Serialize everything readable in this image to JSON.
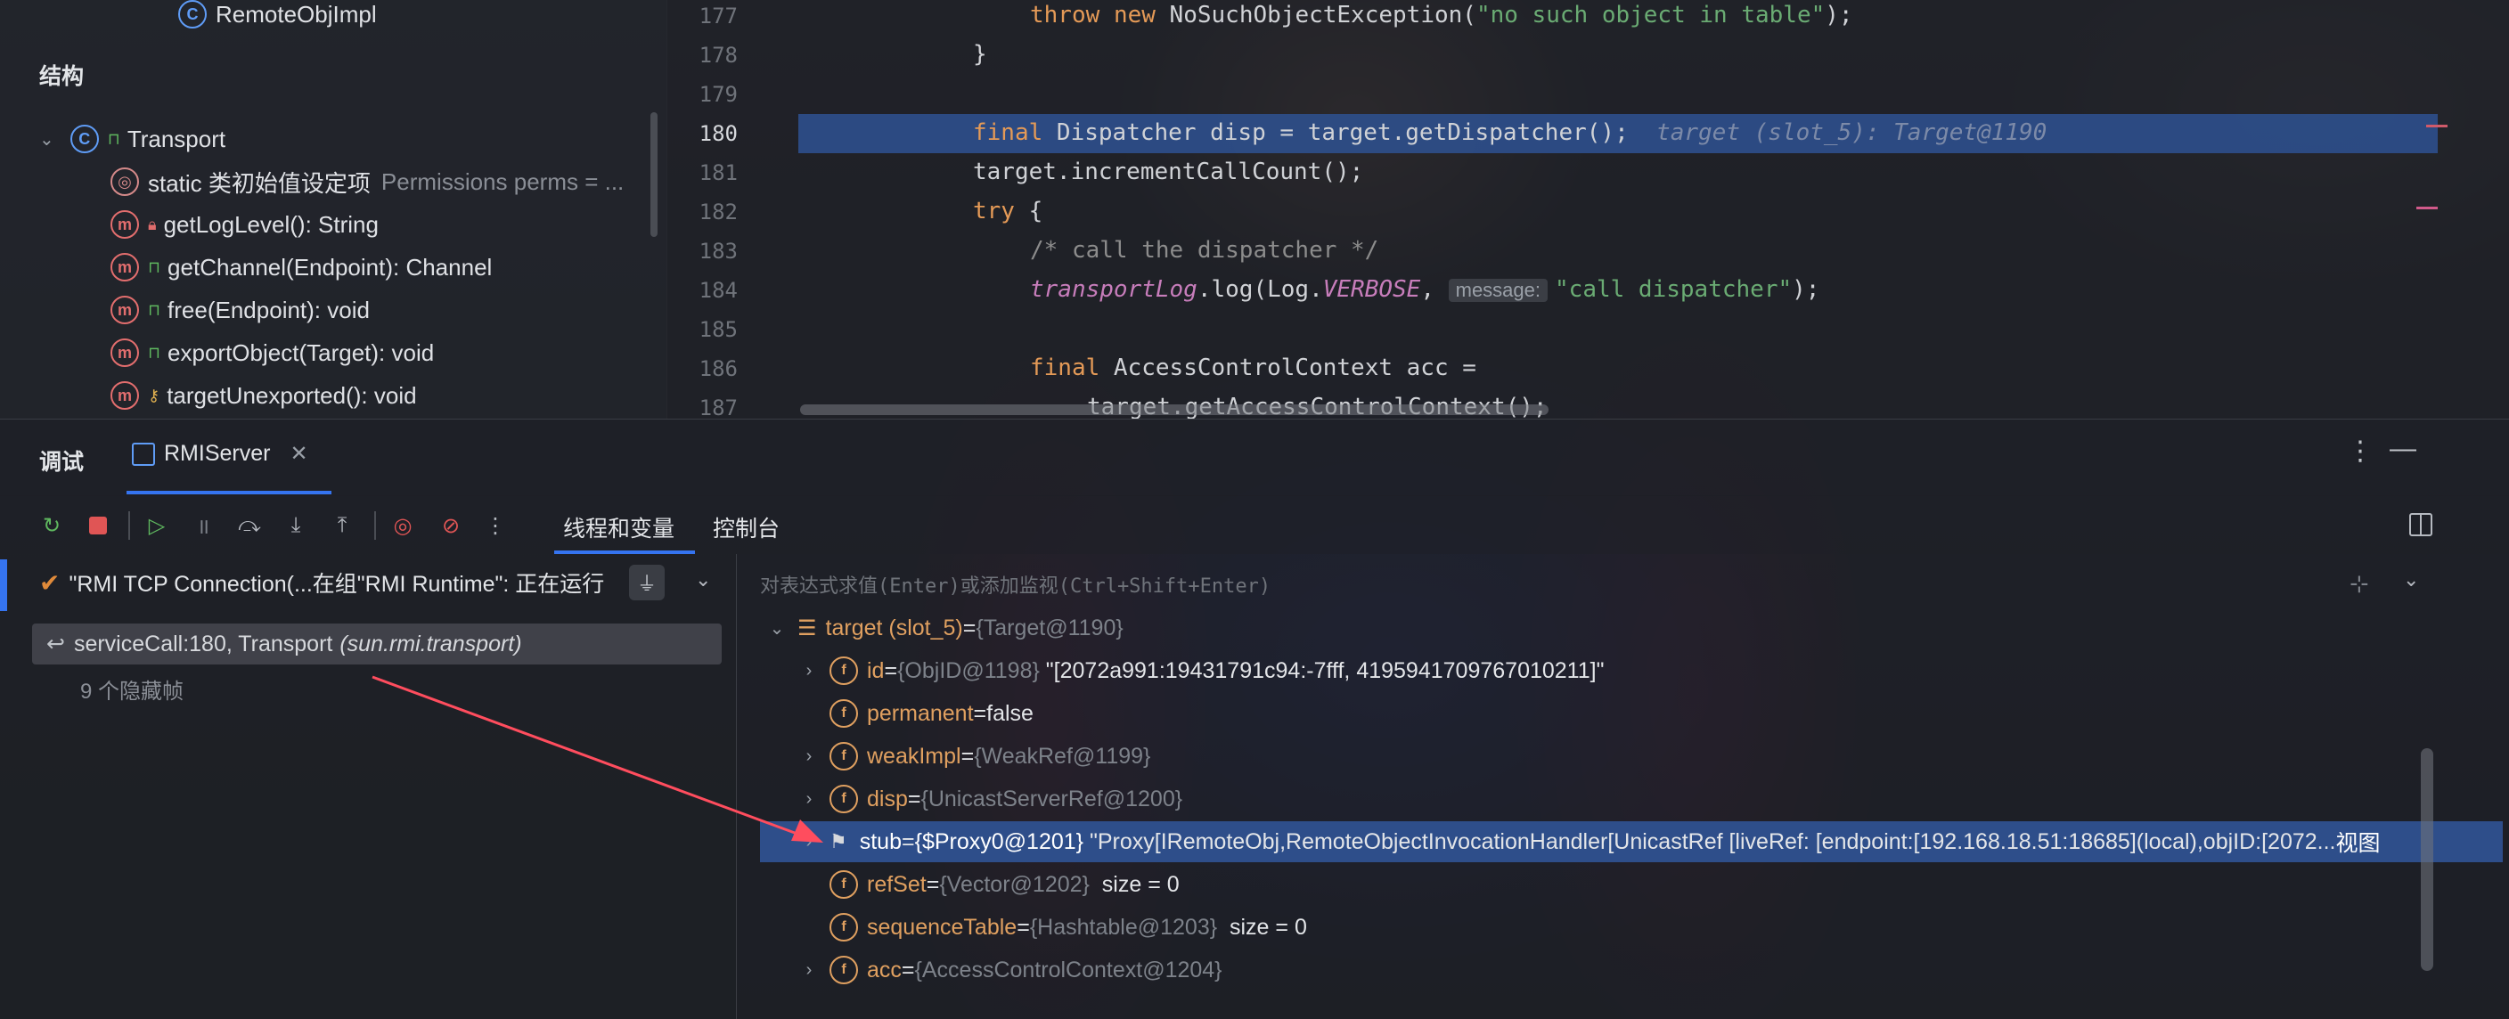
{
  "structure": {
    "top_item": "RemoteObjImpl",
    "section_title": "结构",
    "root": "Transport",
    "items": [
      {
        "label": "static 类初始值设定项",
        "detail": "Permissions perms = ..."
      },
      {
        "label": "getLogLevel(): String"
      },
      {
        "label": "getChannel(Endpoint): Channel"
      },
      {
        "label": "free(Endpoint): void"
      },
      {
        "label": "exportObject(Target): void"
      },
      {
        "label": "targetUnexported(): void"
      }
    ]
  },
  "editor": {
    "line_numbers": [
      "177",
      "178",
      "179",
      "180",
      "181",
      "182",
      "183",
      "184",
      "185",
      "186",
      "187"
    ],
    "line177": {
      "kw1": "throw",
      "kw2": "new",
      "text": " NoSuchObjectException(",
      "str": "\"no such object in table\"",
      "end": ");"
    },
    "line178": "}",
    "line180": {
      "kw": "final",
      "text": " Dispatcher disp = target.getDispatcher();",
      "inline": "target (slot_5): Target@1190"
    },
    "line181": "target.incrementCallCount();",
    "line182": {
      "kw": "try",
      "text": " {"
    },
    "line183": "/* call the dispatcher */",
    "line184": {
      "field": "transportLog",
      "text1": ".log(Log.",
      "const": "VERBOSE",
      "text2": ",",
      "hint": "message:",
      "str": "\"call dispatcher\"",
      "end": ");"
    },
    "line186": {
      "kw": "final",
      "text": " AccessControlContext acc ="
    },
    "line187": "target.getAccessControlContext();"
  },
  "debug": {
    "tab_label": "调试",
    "session": "RMIServer",
    "tab_threads": "线程和变量",
    "tab_console": "控制台"
  },
  "threads": {
    "thread": "\"RMI TCP Connection(...在组\"RMI Runtime\": 正在运行",
    "frame_method": "serviceCall:180, Transport",
    "frame_pkg": "(sun.rmi.transport)",
    "hidden": "9 个隐藏帧"
  },
  "vars": {
    "eval_placeholder": "对表达式求值(Enter)或添加监视(Ctrl+Shift+Enter)",
    "rows": [
      {
        "name": "target (slot_5)",
        "eq": " = ",
        "ref": "{Target@1190}",
        "val": ""
      },
      {
        "name": "id",
        "eq": " = ",
        "ref": "{ObjID@1198}",
        "val": "\"[2072a991:19431791c94:-7fff, 4195941709767010211]\""
      },
      {
        "name": "permanent",
        "eq": " = ",
        "ref": "",
        "val": "false"
      },
      {
        "name": "weakImpl",
        "eq": " = ",
        "ref": "{WeakRef@1199}",
        "val": ""
      },
      {
        "name": "disp",
        "eq": " = ",
        "ref": "{UnicastServerRef@1200}",
        "val": ""
      },
      {
        "name": "stub",
        "eq": " = ",
        "ref": "{$Proxy0@1201}",
        "val": "\"Proxy[IRemoteObj,RemoteObjectInvocationHandler[UnicastRef [liveRef: [endpoint:[192.168.18.51:18685](local),objID:[2072...",
        "link": "视图"
      },
      {
        "name": "refSet",
        "eq": " = ",
        "ref": "{Vector@1202}",
        "val": "size = 0"
      },
      {
        "name": "sequenceTable",
        "eq": " = ",
        "ref": "{Hashtable@1203}",
        "val": "size = 0"
      },
      {
        "name": "acc",
        "eq": " = ",
        "ref": "{AccessControlContext@1204}",
        "val": ""
      }
    ]
  },
  "colors": {
    "selection": "#2e4e8a",
    "accent": "#3574f0",
    "keyword": "#e49a57",
    "string": "#6aab73",
    "arrow": "#ff4d5e"
  }
}
